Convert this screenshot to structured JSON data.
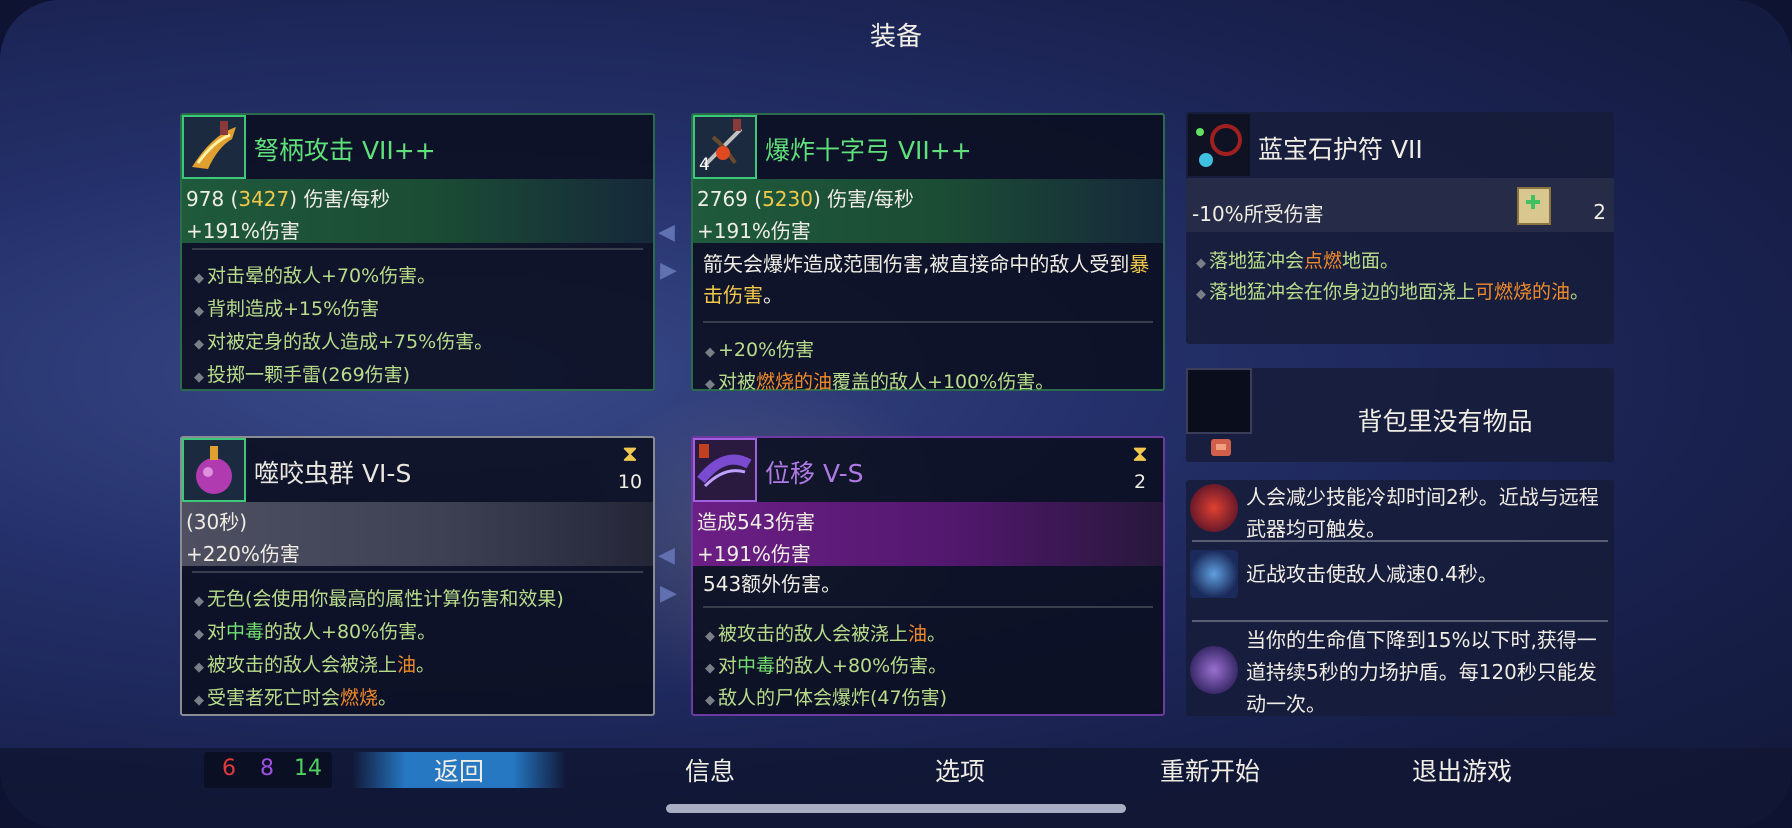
{
  "title": "装备",
  "weapons": [
    {
      "name": "弩柄攻击 VII++",
      "dps": "978",
      "dps_crit": "3427",
      "dps_suffix": "伤害/每秒",
      "bonus": "+191%伤害",
      "bullets": [
        "对击晕的敌人+70%伤害。",
        "背刺造成+15%伤害",
        "对被定身的敌人造成+75%伤害。",
        "投掷一颗手雷(269伤害)"
      ]
    },
    {
      "name": "爆炸十字弓 VII++",
      "count": "4",
      "dps": "2769",
      "dps_crit": "5230",
      "dps_suffix": "伤害/每秒",
      "bonus": "+191%伤害",
      "desc_a": "箭矢会爆炸造成范围伤害,被直接命中的敌人受到",
      "desc_hl": "暴击伤害",
      "desc_b": "。",
      "bullets": [
        "+20%伤害"
      ],
      "b2_a": "对被",
      "b2_hl": "燃烧的油",
      "b2_b": "覆盖的敌人+100%伤害。"
    }
  ],
  "skills": [
    {
      "name": "噬咬虫群 VI-S",
      "cooldown": "10",
      "stat1": "(30秒)",
      "stat2": "+220%伤害",
      "b1": "无色(会使用你最高的属性计算伤害和效果)",
      "b2_a": "对",
      "b2_hl": "中毒",
      "b2_b": "的敌人+80%伤害。",
      "b3_a": "被攻击的敌人会被浇上",
      "b3_hl": "油",
      "b3_b": "。",
      "b4_a": "受害者死亡时会",
      "b4_hl": "燃烧",
      "b4_b": "。"
    },
    {
      "name": "位移 V-S",
      "cooldown": "2",
      "stat1": "造成543伤害",
      "stat2": "+191%伤害",
      "desc": "543额外伤害。",
      "b1_a": "被攻击的敌人会被浇上",
      "b1_hl": "油",
      "b1_b": "。",
      "b2_a": "对",
      "b2_hl": "中毒",
      "b2_b": "的敌人+80%伤害。",
      "b3": "敌人的尸体会爆炸(47伤害)"
    }
  ],
  "amulet": {
    "name": "蓝宝石护符 VII",
    "stat": "-10%所受伤害",
    "scroll_count": "2",
    "b1_a": "落地猛冲会",
    "b1_hl": "点燃",
    "b1_b": "地面。",
    "b2_a": "落地猛冲会在你身边的地面浇上",
    "b2_hl": "可燃烧的油",
    "b2_b": "。"
  },
  "backpack": {
    "empty_text": "背包里没有物品"
  },
  "traits": [
    {
      "text": "人会减少技能冷却时间2秒。近战与远程武器均可触发。"
    },
    {
      "text": "近战攻击使敌人减速0.4秒。"
    },
    {
      "text": "当你的生命值下降到15%以下时,获得一道持续5秒的力场护盾。每120秒只能发动一次。"
    }
  ],
  "stats": {
    "red": "6",
    "purple": "8",
    "green": "14"
  },
  "menu": {
    "back": "返回",
    "info": "信息",
    "options": "选项",
    "restart": "重新开始",
    "quit": "退出游戏"
  },
  "colors": {
    "weapon_border": "#2c6a4c",
    "skill_border": "#8a8c94",
    "skill_purple": "#6c3aa0",
    "highlight_orange": "#f08a2a",
    "highlight_gold": "#f2c84a"
  }
}
